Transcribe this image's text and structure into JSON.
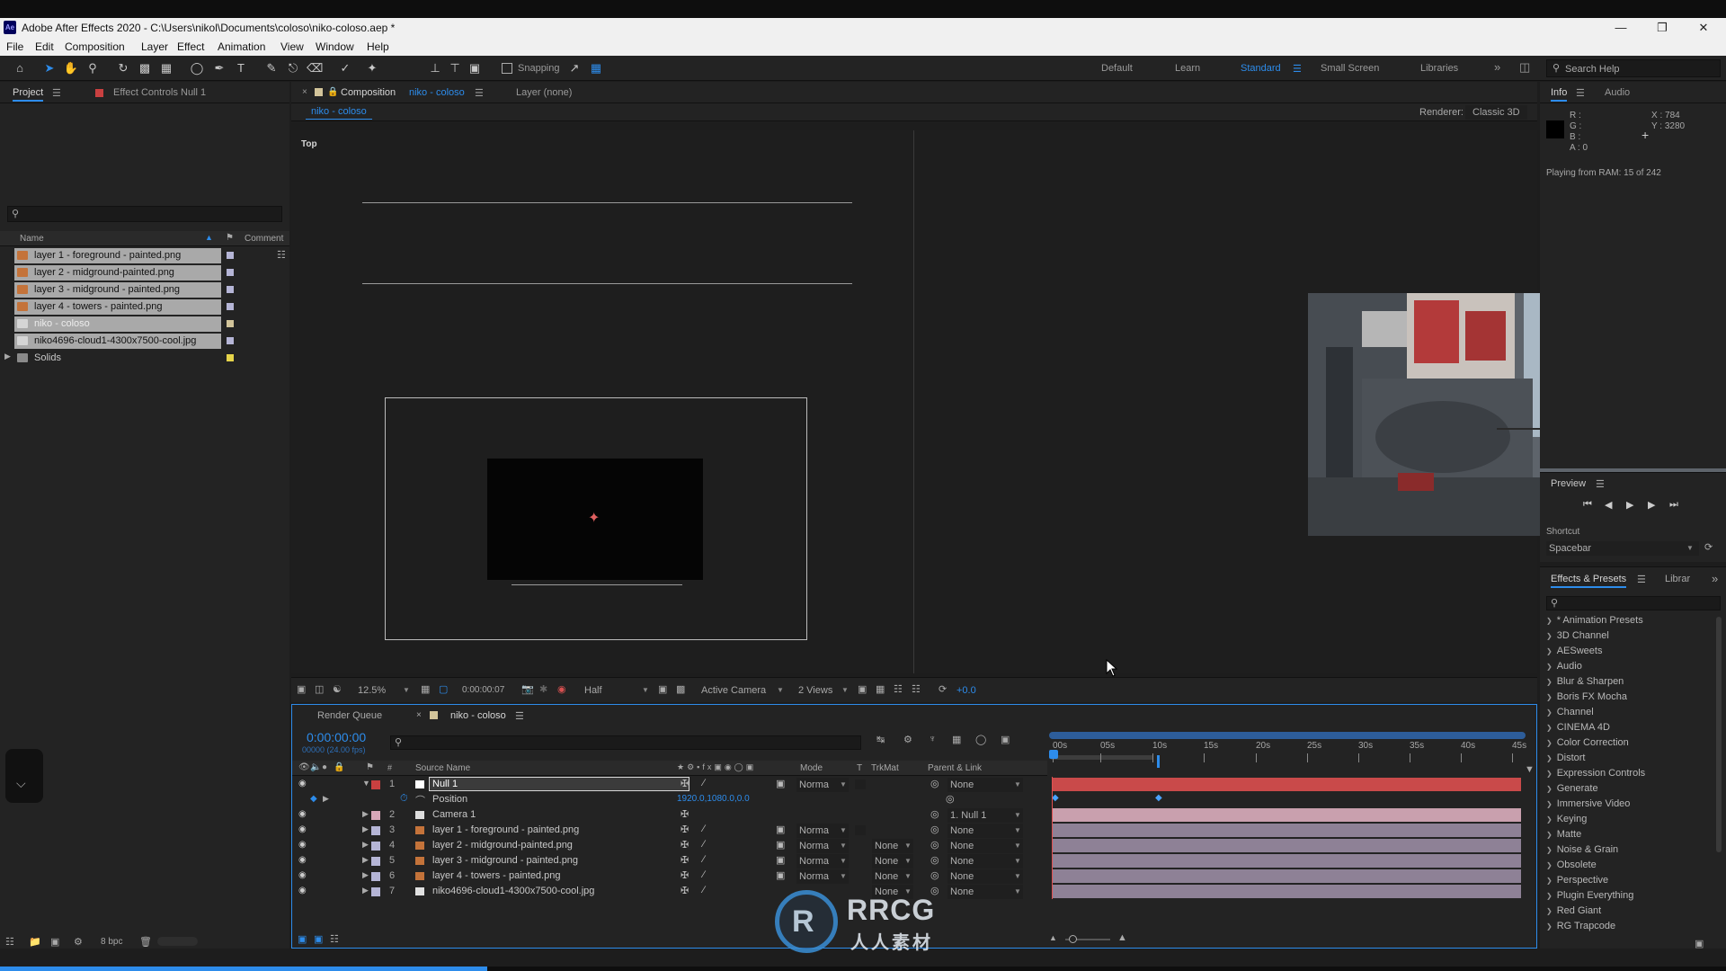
{
  "window": {
    "title": "Adobe After Effects 2020 - C:\\Users\\nikol\\Documents\\coloso\\niko-coloso.aep *",
    "app_icon": "Ae"
  },
  "menu": [
    "File",
    "Edit",
    "Composition",
    "Layer",
    "Effect",
    "Animation",
    "View",
    "Window",
    "Help"
  ],
  "toolbar": {
    "snapping_label": "Snapping",
    "workspaces": [
      "Default",
      "Learn",
      "Standard",
      "Small Screen",
      "Libraries"
    ],
    "active_workspace": "Standard",
    "search_placeholder": "Search Help"
  },
  "project_panel": {
    "tab": "Project",
    "effect_controls_tab": "Effect Controls Null 1",
    "col_name": "Name",
    "col_comment": "Comment",
    "items": [
      {
        "name": "layer 1 - foreground - painted.png",
        "type": "png",
        "label_color": "#b5b5d6"
      },
      {
        "name": "layer 2 - midground-painted.png",
        "type": "png",
        "label_color": "#b5b5d6"
      },
      {
        "name": "layer 3 - midground - painted.png",
        "type": "png",
        "label_color": "#b5b5d6"
      },
      {
        "name": "layer 4 - towers - painted.png",
        "type": "png",
        "label_color": "#b5b5d6"
      },
      {
        "name": "niko - coloso",
        "type": "comp",
        "label_color": "#d2c49a"
      },
      {
        "name": "niko4696-cloud1-4300x7500-cool.jpg",
        "type": "jpg",
        "label_color": "#b5b5d6"
      },
      {
        "name": "Solids",
        "type": "folder",
        "label_color": "#e6d44a"
      }
    ],
    "bpc": "8 bpc"
  },
  "composition": {
    "tab_prefix": "Composition",
    "tab_name": "niko - coloso",
    "layer_tab": "Layer (none)",
    "subtab": "niko - coloso",
    "renderer_label": "Renderer:",
    "renderer": "Classic 3D",
    "view_label": "Top",
    "footer": {
      "zoom": "12.5%",
      "timecode": "0:00:00:07",
      "resolution": "Half",
      "camera": "Active Camera",
      "views": "2 Views",
      "exposure": "+0.0"
    }
  },
  "info": {
    "tab": "Info",
    "audio_tab": "Audio",
    "r": "R :",
    "g": "G :",
    "b": "B :",
    "a": "A : 0",
    "x": "X : 784",
    "y": "Y : 3280",
    "playing": "Playing from RAM: 15 of 242"
  },
  "preview": {
    "tab": "Preview",
    "shortcut_label": "Shortcut",
    "shortcut": "Spacebar"
  },
  "effects": {
    "tab": "Effects & Presets",
    "libraries_tab": "Librar",
    "items": [
      "* Animation Presets",
      "3D Channel",
      "AESweets",
      "Audio",
      "Blur & Sharpen",
      "Boris FX Mocha",
      "Channel",
      "CINEMA 4D",
      "Color Correction",
      "Distort",
      "Expression Controls",
      "Generate",
      "Immersive Video",
      "Keying",
      "Matte",
      "Noise & Grain",
      "Obsolete",
      "Perspective",
      "Plugin Everything",
      "Red Giant",
      "RG Trapcode"
    ]
  },
  "timeline": {
    "render_queue": "Render Queue",
    "comp_tab": "niko - coloso",
    "timecode": "0:00:00:00",
    "fps": "00000 (24.00 fps)",
    "headers": {
      "source_name": "Source Name",
      "mode": "Mode",
      "t": "T",
      "trkmat": "TrkMat",
      "parent": "Parent & Link"
    },
    "ruler": [
      "00s",
      "05s",
      "10s",
      "15s",
      "20s",
      "25s",
      "30s",
      "35s",
      "40s",
      "45s"
    ],
    "position_label": "Position",
    "position_value": "1920.0,1080.0,0.0",
    "layers": [
      {
        "num": "1",
        "name": "Null 1",
        "label": "#c94040",
        "mode": "Norma",
        "trkmat": "",
        "parent": "None",
        "type": "null"
      },
      {
        "num": "2",
        "name": "Camera 1",
        "label": "#d7a7b9",
        "mode": "",
        "trkmat": "",
        "parent": "1. Null 1",
        "type": "camera"
      },
      {
        "num": "3",
        "name": "layer 1 - foreground - painted.png",
        "label": "#b5b5d6",
        "mode": "Norma",
        "trkmat": "",
        "parent": "None",
        "type": "png"
      },
      {
        "num": "4",
        "name": "layer 2 - midground-painted.png",
        "label": "#b5b5d6",
        "mode": "Norma",
        "trkmat": "None",
        "parent": "None",
        "type": "png"
      },
      {
        "num": "5",
        "name": "layer 3 - midground - painted.png",
        "label": "#b5b5d6",
        "mode": "Norma",
        "trkmat": "None",
        "parent": "None",
        "type": "png"
      },
      {
        "num": "6",
        "name": "layer 4 - towers - painted.png",
        "label": "#b5b5d6",
        "mode": "Norma",
        "trkmat": "None",
        "parent": "None",
        "type": "png"
      },
      {
        "num": "7",
        "name": "niko4696-cloud1-4300x7500-cool.jpg",
        "label": "#b5b5d6",
        "mode": "",
        "trkmat": "None",
        "parent": "None",
        "type": "jpg"
      }
    ]
  },
  "watermark": {
    "brand": "RRCG",
    "sub": "人人素材"
  },
  "colors": {
    "accent": "#2d8ceb",
    "null_bar": "#c94a4a",
    "layer_bar": "#8e8196",
    "camera_bar": "#c9a0ae"
  }
}
